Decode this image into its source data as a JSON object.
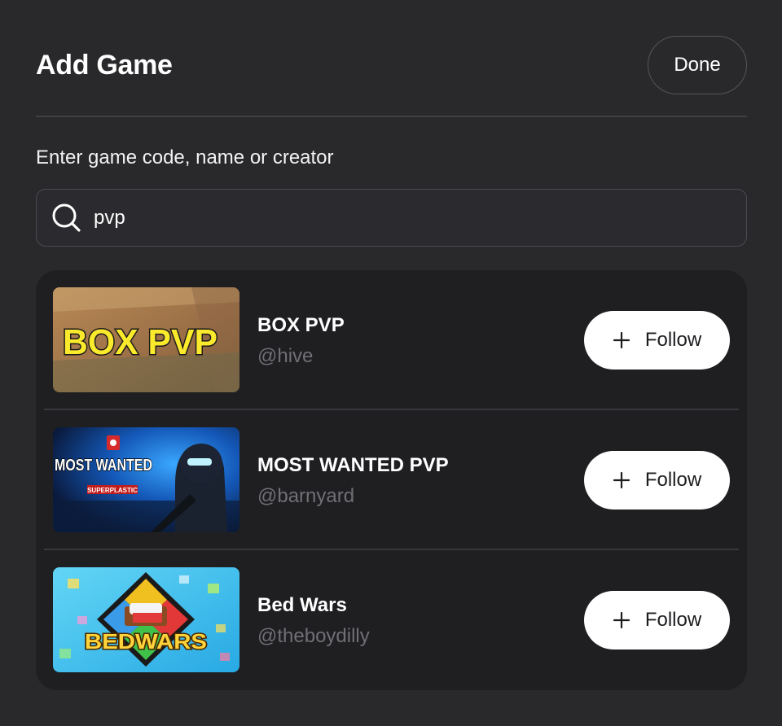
{
  "header": {
    "title": "Add Game",
    "done_label": "Done"
  },
  "search": {
    "label": "Enter game code, name or creator",
    "value": "pvp",
    "icon": "search-icon"
  },
  "results": [
    {
      "name": "BOX PVP",
      "creator": "@hive",
      "thumbnail_text": "BOX PVP",
      "follow_label": "Follow"
    },
    {
      "name": "MOST WANTED PVP",
      "creator": "@barnyard",
      "thumbnail_text": "MOST WANTED",
      "thumbnail_subtext": "SUPERPLASTIC",
      "follow_label": "Follow"
    },
    {
      "name": "Bed Wars",
      "creator": "@theboydilly",
      "thumbnail_text": "BEDWARS",
      "follow_label": "Follow"
    }
  ],
  "colors": {
    "background": "#29292c",
    "list_background": "#1f1f22",
    "muted_text": "#6f6f75",
    "button_bg": "#ffffff"
  }
}
